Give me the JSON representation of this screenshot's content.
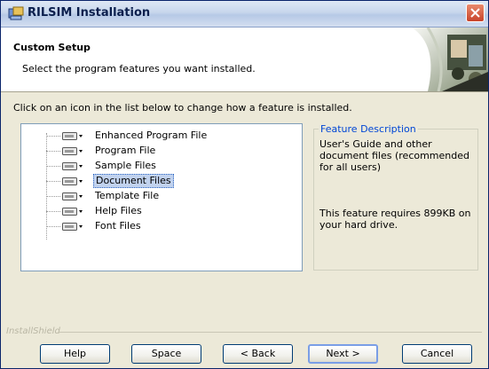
{
  "window": {
    "title": "RILSIM Installation"
  },
  "header": {
    "title": "Custom Setup",
    "subtitle": "Select the program features you want installed."
  },
  "instruction": "Click on an icon in the list below to change how a feature is installed.",
  "features": [
    {
      "label": "Enhanced Program File",
      "selected": false
    },
    {
      "label": "Program File",
      "selected": false
    },
    {
      "label": "Sample Files",
      "selected": false
    },
    {
      "label": "Document Files",
      "selected": true
    },
    {
      "label": "Template File",
      "selected": false
    },
    {
      "label": "Help Files",
      "selected": false
    },
    {
      "label": "Font Files",
      "selected": false
    }
  ],
  "description": {
    "legend": "Feature Description",
    "text": "User's Guide and other document files (recommended for all users)",
    "size_text": "This feature requires 899KB on your hard drive."
  },
  "brand": "InstallShield",
  "buttons": {
    "help": "Help",
    "space": "Space",
    "back": "< Back",
    "next": "Next >",
    "cancel": "Cancel"
  },
  "colors": {
    "selection": "#c1d2ee",
    "legend": "#0046d5",
    "close": "#c8432a"
  }
}
